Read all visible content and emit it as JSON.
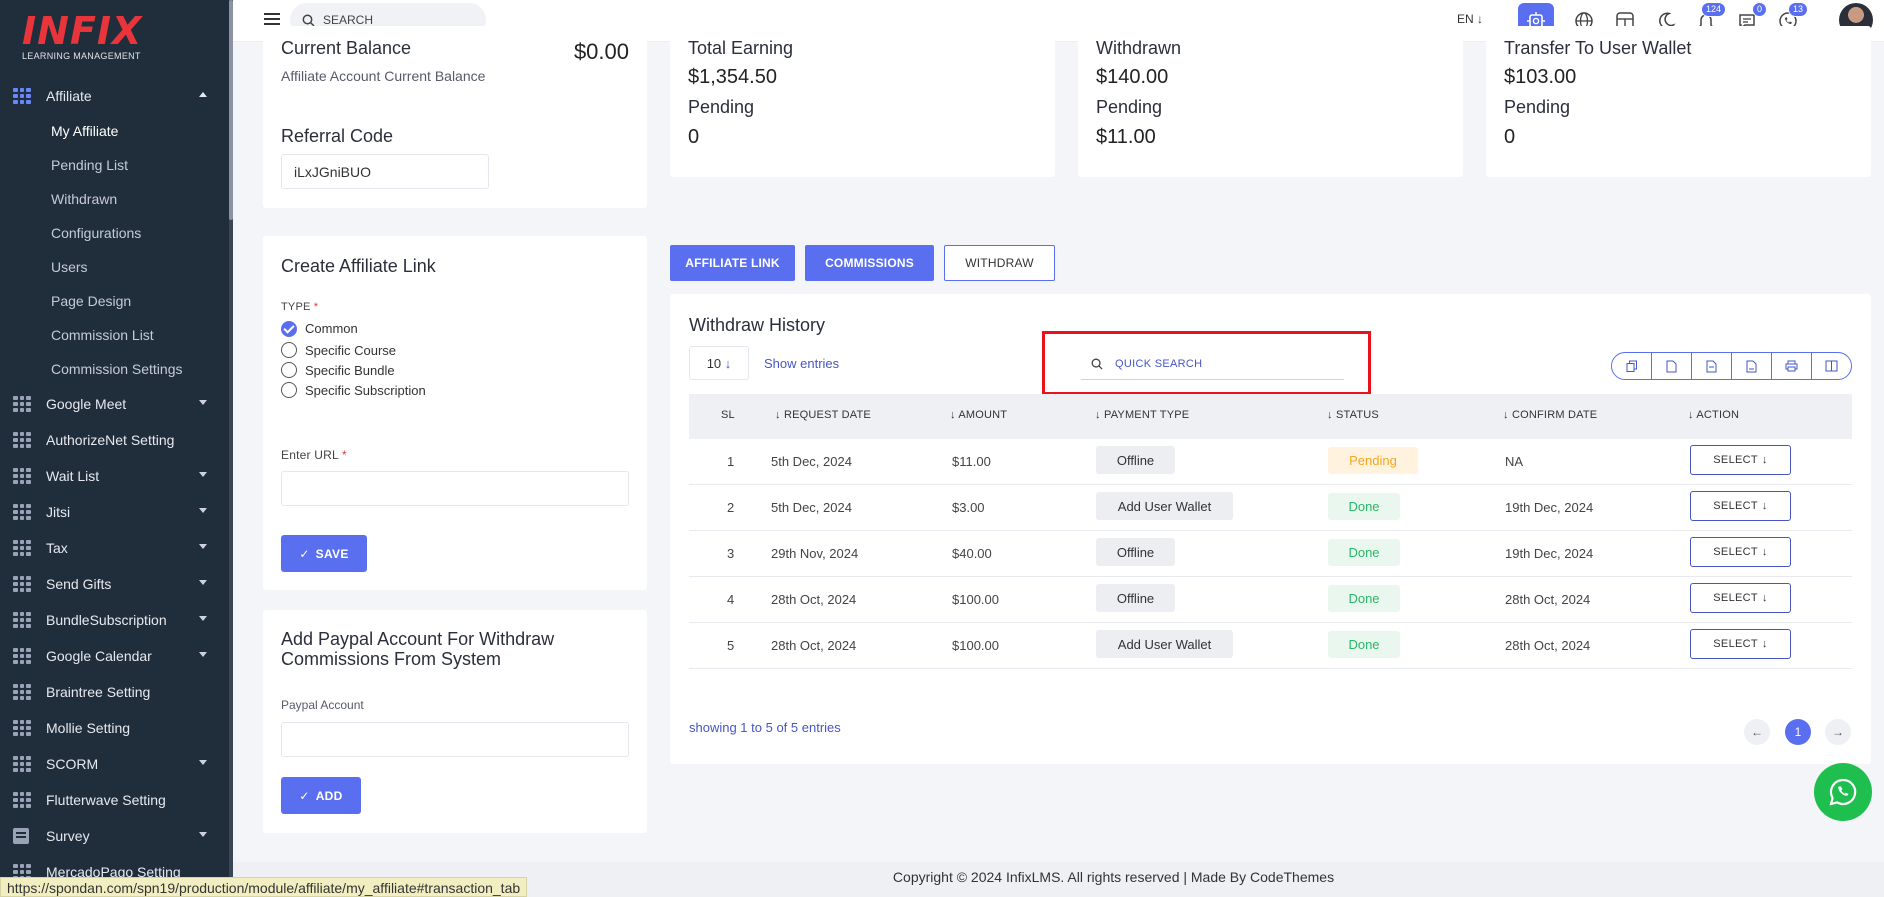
{
  "app": {
    "logo_text": "INFIX",
    "logo_sub": "LEARNING MANAGEMENT",
    "colors": {
      "accent": "#5a6ff0",
      "sidebar": "#202e3b",
      "danger": "#e8343b",
      "success": "#2bb768",
      "warning": "#f4a623"
    }
  },
  "sidebar": {
    "items": [
      {
        "label": "Affiliate",
        "icon": "grid-icon",
        "expanded": true,
        "sub": [
          "My Affiliate",
          "Pending List",
          "Withdrawn",
          "Configurations",
          "Users",
          "Page Design",
          "Commission List",
          "Commission Settings"
        ]
      },
      {
        "label": "Google Meet",
        "icon": "grid-icon",
        "caret": true
      },
      {
        "label": "AuthorizeNet Setting",
        "icon": "grid-icon",
        "caret": false
      },
      {
        "label": "Wait List",
        "icon": "grid-icon",
        "caret": true
      },
      {
        "label": "Jitsi",
        "icon": "grid-icon",
        "caret": true
      },
      {
        "label": "Tax",
        "icon": "grid-icon",
        "caret": true
      },
      {
        "label": "Send Gifts",
        "icon": "grid-icon",
        "caret": true
      },
      {
        "label": "BundleSubscription",
        "icon": "grid-icon",
        "caret": true
      },
      {
        "label": "Google Calendar",
        "icon": "grid-icon",
        "caret": true
      },
      {
        "label": "Braintree Setting",
        "icon": "grid-icon",
        "caret": false
      },
      {
        "label": "Mollie Setting",
        "icon": "grid-icon",
        "caret": false
      },
      {
        "label": "SCORM",
        "icon": "grid-icon",
        "caret": true
      },
      {
        "label": "Flutterwave Setting",
        "icon": "grid-icon",
        "caret": false
      },
      {
        "label": "Survey",
        "icon": "survey-icon",
        "caret": true
      },
      {
        "label": "MercadoPago Setting",
        "icon": "grid-icon",
        "caret": false
      }
    ]
  },
  "topbar": {
    "search_placeholder": "SEARCH",
    "lang": "EN",
    "badges": {
      "notifications": "124",
      "messages": "0",
      "chat": "13"
    }
  },
  "balance": {
    "title": "Current Balance",
    "amount": "$0.00",
    "subtitle": "Affiliate Account Current Balance",
    "referral_label": "Referral Code",
    "referral_code": "iLxJGniBUO"
  },
  "stats": [
    {
      "title": "Total Earning",
      "amount": "$1,354.50",
      "pending_label": "Pending",
      "pending": "0"
    },
    {
      "title": "Withdrawn",
      "amount": "$140.00",
      "pending_label": "Pending",
      "pending": "$11.00"
    },
    {
      "title": "Transfer To User Wallet",
      "amount": "$103.00",
      "pending_label": "Pending",
      "pending": "0"
    }
  ],
  "create_link": {
    "title": "Create Affiliate Link",
    "type_label": "TYPE",
    "options": [
      "Common",
      "Specific Course",
      "Specific Bundle",
      "Specific Subscription"
    ],
    "selected": 0,
    "url_label": "Enter URL",
    "save_label": "SAVE"
  },
  "paypal": {
    "title": "Add Paypal Account For Withdraw Commissions From System",
    "field_label": "Paypal Account",
    "add_label": "ADD"
  },
  "tabs": [
    "AFFILIATE LINK",
    "COMMISSIONS",
    "WITHDRAW"
  ],
  "history": {
    "title": "Withdraw History",
    "page_size": "10",
    "show_entries": "Show entries",
    "quick_search_placeholder": "QUICK SEARCH",
    "columns": [
      "SL",
      "REQUEST DATE",
      "AMOUNT",
      "PAYMENT TYPE",
      "STATUS",
      "CONFIRM DATE",
      "ACTION"
    ],
    "rows": [
      {
        "sl": "1",
        "request_date": "5th Dec, 2024",
        "amount": "$11.00",
        "payment_type": "Offline",
        "status": "Pending",
        "confirm_date": "NA",
        "action": "SELECT"
      },
      {
        "sl": "2",
        "request_date": "5th Dec, 2024",
        "amount": "$3.00",
        "payment_type": "Add User Wallet",
        "status": "Done",
        "confirm_date": "19th Dec, 2024",
        "action": "SELECT"
      },
      {
        "sl": "3",
        "request_date": "29th Nov, 2024",
        "amount": "$40.00",
        "payment_type": "Offline",
        "status": "Done",
        "confirm_date": "19th Dec, 2024",
        "action": "SELECT"
      },
      {
        "sl": "4",
        "request_date": "28th Oct, 2024",
        "amount": "$100.00",
        "payment_type": "Offline",
        "status": "Done",
        "confirm_date": "28th Oct, 2024",
        "action": "SELECT"
      },
      {
        "sl": "5",
        "request_date": "28th Oct, 2024",
        "amount": "$100.00",
        "payment_type": "Add User Wallet",
        "status": "Done",
        "confirm_date": "28th Oct, 2024",
        "action": "SELECT"
      }
    ],
    "summary": "showing 1 to 5 of 5 entries",
    "current_page": "1"
  },
  "footer": {
    "text": "Copyright © 2024 InfixLMS. All rights reserved | Made By CodeThemes"
  },
  "status_url": "https://spondan.com/spn19/production/module/affiliate/my_affiliate#transaction_tab"
}
